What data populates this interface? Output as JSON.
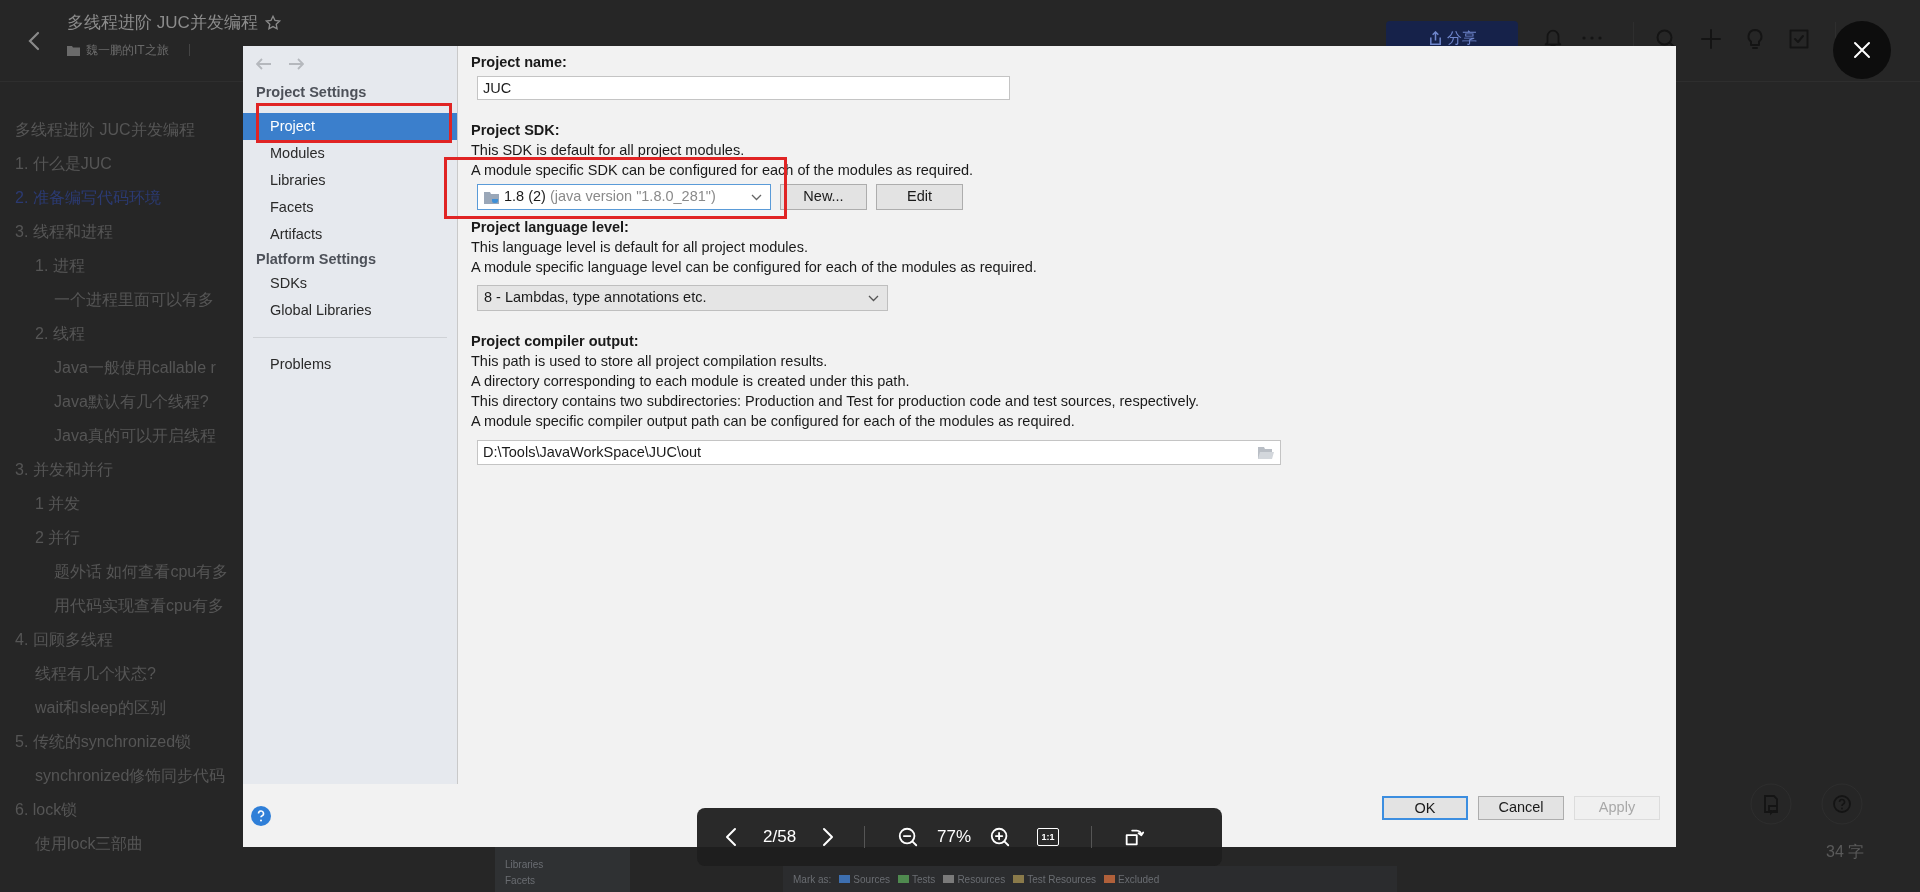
{
  "header": {
    "title": "多线程进阶 JUC并发编程",
    "notebook": "魏一鹏的IT之旅",
    "share_label": "分享"
  },
  "outline": [
    {
      "text": "多线程进阶 JUC并发编程",
      "selected": false
    },
    {
      "text": "1. 什么是JUC",
      "selected": false
    },
    {
      "text": "2. 准备编写代码环境",
      "selected": true
    },
    {
      "text": "3. 线程和进程",
      "selected": false,
      "children": [
        {
          "text": "1. 进程",
          "selected": false,
          "children": [
            {
              "text": "一个进程里面可以有多",
              "selected": false
            }
          ]
        },
        {
          "text": "2. 线程",
          "selected": false,
          "children": [
            {
              "text": "Java一般使用callable r",
              "selected": false
            },
            {
              "text": "Java默认有几个线程?",
              "selected": false
            },
            {
              "text": "Java真的可以开启线程",
              "selected": false
            }
          ]
        }
      ]
    },
    {
      "text": "3. 并发和并行",
      "selected": false,
      "children": [
        {
          "text": "1 并发",
          "selected": false
        },
        {
          "text": "2 并行",
          "selected": false,
          "children": [
            {
              "text": "题外话 如何查看cpu有多",
              "selected": false
            },
            {
              "text": "用代码实现查看cpu有多",
              "selected": false
            }
          ]
        }
      ]
    },
    {
      "text": "4. 回顾多线程",
      "selected": false,
      "children": [
        {
          "text": "线程有几个状态?",
          "selected": false
        },
        {
          "text": "wait和sleep的区别",
          "selected": false
        }
      ]
    },
    {
      "text": "5. 传统的synchronized锁",
      "selected": false,
      "children": [
        {
          "text": "synchronized修饰同步代码",
          "selected": false
        }
      ]
    },
    {
      "text": "6. lock锁",
      "selected": false,
      "children": [
        {
          "text": "使用lock三部曲",
          "selected": false
        }
      ]
    }
  ],
  "dialog": {
    "sidebar": {
      "sections": [
        {
          "header": "Project Settings",
          "items": [
            {
              "label": "Project",
              "selected": true
            },
            {
              "label": "Modules",
              "selected": false
            },
            {
              "label": "Libraries",
              "selected": false
            },
            {
              "label": "Facets",
              "selected": false
            },
            {
              "label": "Artifacts",
              "selected": false
            }
          ]
        },
        {
          "header": "Platform Settings",
          "items": [
            {
              "label": "SDKs",
              "selected": false
            },
            {
              "label": "Global Libraries",
              "selected": false
            }
          ]
        }
      ],
      "footer_items": [
        {
          "label": "Problems",
          "selected": false
        }
      ]
    },
    "project_name": {
      "label": "Project name:",
      "value": "JUC"
    },
    "sdk": {
      "label": "Project SDK:",
      "descriptions": [
        "This SDK is default for all project modules.",
        "A module specific SDK can be configured for each of the modules as required."
      ],
      "name": "1.8 (2)",
      "detail": "(java version \"1.8.0_281\")",
      "buttons": [
        "New...",
        "Edit"
      ]
    },
    "language_level": {
      "label": "Project language level:",
      "descriptions": [
        "This language level is default for all project modules.",
        "A module specific language level can be configured for each of the modules as required."
      ],
      "value": "8 - Lambdas, type annotations etc."
    },
    "compiler_output": {
      "label": "Project compiler output:",
      "descriptions": [
        "This path is used to store all project compilation results.",
        "A directory corresponding to each module is created under this path.",
        "This directory contains two subdirectories: Production and Test for production code and test sources, respectively.",
        "A module specific compiler output path can be configured for each of the modules as required."
      ],
      "value": "D:\\Tools\\JavaWorkSpace\\JUC\\out"
    },
    "buttons": [
      {
        "label": "OK",
        "default": true,
        "disabled": false
      },
      {
        "label": "Cancel",
        "default": false,
        "disabled": false
      },
      {
        "label": "Apply",
        "default": false,
        "disabled": true
      }
    ]
  },
  "next_image_strip": {
    "sidebar_items": [
      "Libraries",
      "Facets"
    ],
    "mark_as_label": "Mark as:",
    "folder_types": [
      {
        "label": "Sources",
        "color": "#3d6fb0"
      },
      {
        "label": "Tests",
        "color": "#4f8a4f"
      },
      {
        "label": "Resources",
        "color": "#7a7a7a"
      },
      {
        "label": "Test Resources",
        "color": "#8a7a4a"
      },
      {
        "label": "Excluded",
        "color": "#b0603a"
      }
    ]
  },
  "viewer_toolbar": {
    "page": "2/58",
    "zoom": "77%",
    "actual_size": "1:1"
  },
  "word_count": "34 字"
}
